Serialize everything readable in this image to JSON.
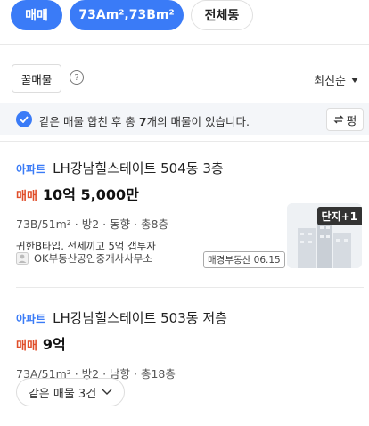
{
  "filters": {
    "trade": "매매",
    "area": "73Am²,73Bm²",
    "dong": "전체동"
  },
  "toolbar": {
    "featured": "꿀매물",
    "help": "?",
    "sort": "최신순"
  },
  "merge_notice": {
    "prefix": "같은 매물 합친 후 총 ",
    "count": "7",
    "suffix": "개의 매물이 있습니다.",
    "toggle": "펑"
  },
  "listings": [
    {
      "type": "아파트",
      "name": "LH강남힐스테이트 504동 3층",
      "trade": "매매",
      "price": "10억 5,000만",
      "specs": "73B/51m² · 방2 · 동향 · 총8층",
      "desc": "귀한B타입. 전세끼고 5억 갭투자",
      "agent": "OK부동산공인중개사사무소",
      "source": "매경부동산 06.15",
      "thumb_badge": "단지+1"
    },
    {
      "type": "아파트",
      "name": "LH강남힐스테이트 503동 저층",
      "trade": "매매",
      "price": "9억",
      "specs": "73A/51m² · 방2 · 남향 · 총18층",
      "more": "같은 매물 3건"
    }
  ]
}
